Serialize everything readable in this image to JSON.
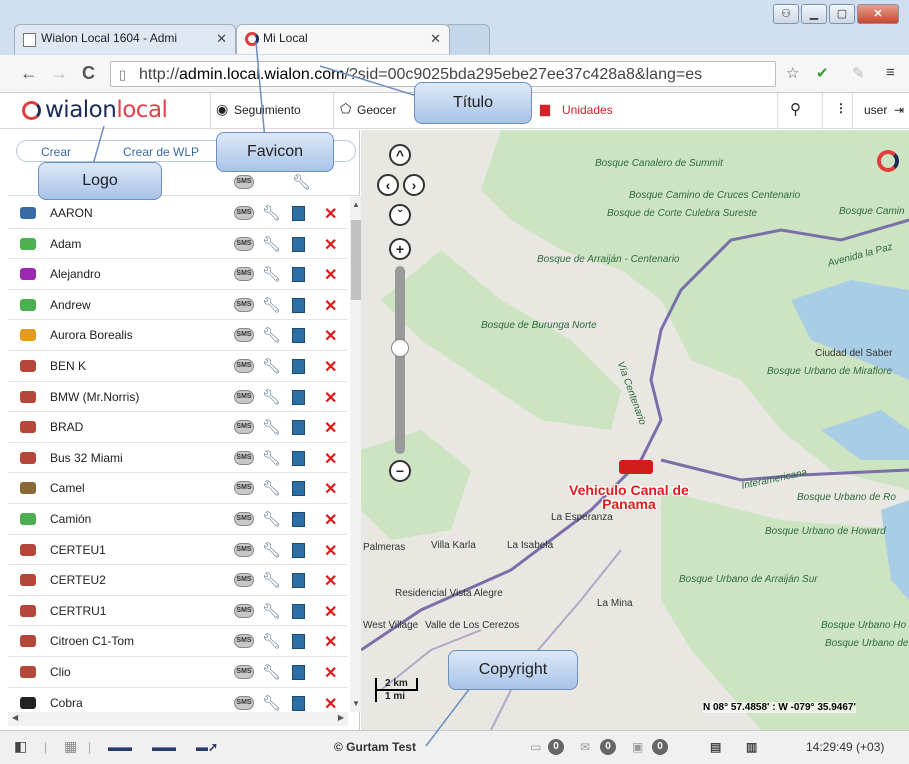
{
  "browser": {
    "tabs": [
      {
        "label": "Wialon Local 1604 - Admi",
        "active": false
      },
      {
        "label": "Mi Local",
        "active": true
      }
    ],
    "url_prefix": "http://",
    "url_host": "admin.local.wialon.com",
    "url_rest": "/?sid=00c9025bda295ebe27ee37c428a8&lang=es"
  },
  "app": {
    "logo_main": "wialon",
    "logo_sub": "local",
    "menu": {
      "tracking": "Seguimiento",
      "geofences": "Geocer",
      "units": "Unidades",
      "user": "user"
    },
    "buttons": {
      "create": "Crear",
      "create_wlp": "Crear de WLP"
    }
  },
  "units": [
    {
      "name": "AARON",
      "icon_color": "#3a6aa6"
    },
    {
      "name": "Adam",
      "icon_color": "#4caf50"
    },
    {
      "name": "Alejandro",
      "icon_color": "#9c27b0"
    },
    {
      "name": "Andrew",
      "icon_color": "#4caf50"
    },
    {
      "name": "Aurora Borealis",
      "icon_color": "#e39b1f"
    },
    {
      "name": "BEN K",
      "icon_color": "#b5473a"
    },
    {
      "name": "BMW (Mr.Norris)",
      "icon_color": "#b5473a"
    },
    {
      "name": "BRAD",
      "icon_color": "#b5473a"
    },
    {
      "name": "Bus 32 Miami",
      "icon_color": "#b5473a"
    },
    {
      "name": "Camel",
      "icon_color": "#8a6a3a"
    },
    {
      "name": "Camión",
      "icon_color": "#4caf50"
    },
    {
      "name": "CERTEU1",
      "icon_color": "#b5473a"
    },
    {
      "name": "CERTEU2",
      "icon_color": "#b5473a"
    },
    {
      "name": "CERTRU1",
      "icon_color": "#b5473a"
    },
    {
      "name": "Citroen C1-Tom",
      "icon_color": "#b5473a"
    },
    {
      "name": "Clio",
      "icon_color": "#b5473a"
    },
    {
      "name": "Cobra",
      "icon_color": "#222222"
    }
  ],
  "map": {
    "labels": [
      {
        "text": "Bosque Canalero de Summit",
        "cls": ""
      },
      {
        "text": "Bosque Camino de Cruces Centenario",
        "cls": ""
      },
      {
        "text": "Bosque de Corte Culebra Sureste",
        "cls": ""
      },
      {
        "text": "Bosque Camin",
        "cls": ""
      },
      {
        "text": "Avenida la Paz",
        "cls": ""
      },
      {
        "text": "Bosque de Arraiján - Centenario",
        "cls": ""
      },
      {
        "text": "Bosque de Burunga Norte",
        "cls": ""
      },
      {
        "text": "Ciudad del Saber",
        "cls": "town"
      },
      {
        "text": "Bosque Urbano de Miraflore",
        "cls": ""
      },
      {
        "text": "Vía Centenario",
        "cls": ""
      },
      {
        "text": "Interamericana",
        "cls": ""
      },
      {
        "text": "Bosque Urbano de Ro",
        "cls": ""
      },
      {
        "text": "Bosque Urbano de Howard",
        "cls": ""
      },
      {
        "text": "Palmeras",
        "cls": "town"
      },
      {
        "text": "Villa Karla",
        "cls": "town"
      },
      {
        "text": "La Isabela",
        "cls": "town"
      },
      {
        "text": "La Esperanza",
        "cls": "town"
      },
      {
        "text": "Bosque Urbano de Arraiján Sur",
        "cls": ""
      },
      {
        "text": "Residencial Vista Alegre",
        "cls": "town"
      },
      {
        "text": "La Mina",
        "cls": "town"
      },
      {
        "text": "West Village",
        "cls": "town"
      },
      {
        "text": "Valle de Los Cerezos",
        "cls": "town"
      },
      {
        "text": "Bosque Urbano Ho",
        "cls": ""
      },
      {
        "text": "Bosque Urbano de V",
        "cls": ""
      }
    ],
    "vehicle_label_line1": "Vehiculo Canal de",
    "vehicle_label_line2": "Panama",
    "scale_km": "2 km",
    "scale_mi": "1 mi",
    "coords": "N 08° 57.4858' : W -079° 35.9467'"
  },
  "status": {
    "copyright": "© Gurtam Test",
    "badge1": "0",
    "badge2": "0",
    "badge3": "0",
    "time": "14:29:49 (+03)"
  },
  "callouts": {
    "titulo": "Título",
    "favicon": "Favicon",
    "logo": "Logo",
    "copyright": "Copyright"
  }
}
